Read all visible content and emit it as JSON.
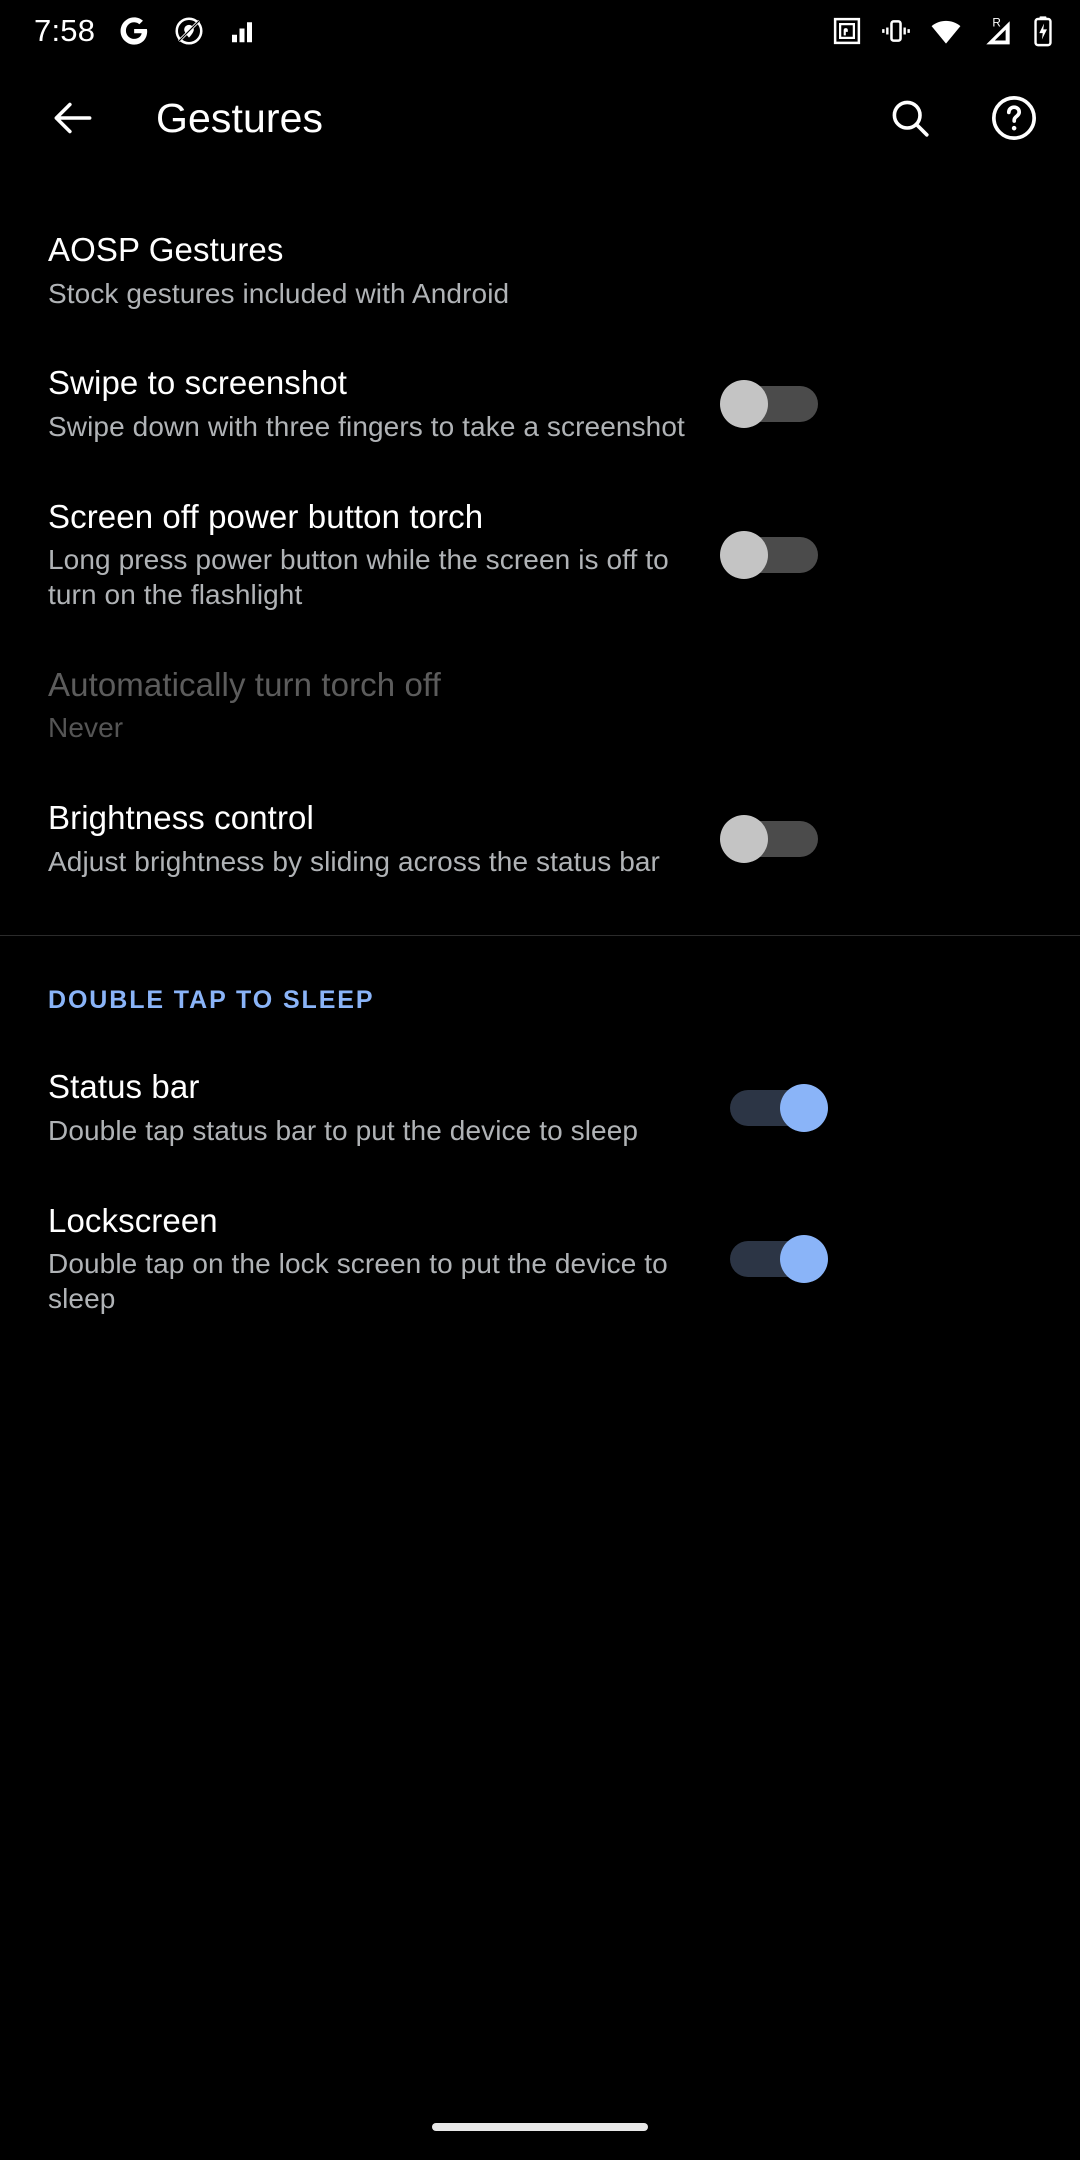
{
  "status_bar": {
    "time": "7:58",
    "left_icons": [
      "google-g-icon",
      "no-location-icon",
      "signal-bars-icon"
    ],
    "right_icons": [
      "nfc-icon",
      "vibrate-icon",
      "wifi-icon",
      "roaming-signal-icon",
      "battery-charging-icon"
    ],
    "roaming_label": "R"
  },
  "app_bar": {
    "title": "Gestures",
    "back_icon": "arrow-back-icon",
    "search_icon": "search-icon",
    "help_icon": "help-circle-icon"
  },
  "colors": {
    "background": "#000000",
    "accent": "#8ab4f8",
    "primary_text": "#ffffff",
    "secondary_text": "#b0b3b6",
    "disabled_text": "#5c5c5c",
    "switch_off_track": "#4b4b4b",
    "switch_off_thumb": "#c4c4c4",
    "switch_on_track": "#2c3545",
    "switch_on_thumb": "#8ab4f8",
    "divider": "#2b2b2b"
  },
  "sections": [
    {
      "category": null,
      "items": [
        {
          "name": "aosp-gestures",
          "title": "AOSP Gestures",
          "summary": "Stock gestures included with Android",
          "has_switch": false,
          "switch_on": null,
          "disabled": false
        },
        {
          "name": "swipe-to-screenshot",
          "title": "Swipe to screenshot",
          "summary": "Swipe down with three fingers to take a screenshot",
          "has_switch": true,
          "switch_on": false,
          "disabled": false
        },
        {
          "name": "screen-off-power-button-torch",
          "title": "Screen off power button torch",
          "summary": "Long press power button while the screen is off to turn on the flashlight",
          "has_switch": true,
          "switch_on": false,
          "disabled": false
        },
        {
          "name": "automatically-turn-torch-off",
          "title": "Automatically turn torch off",
          "summary": "Never",
          "has_switch": false,
          "switch_on": null,
          "disabled": true
        },
        {
          "name": "brightness-control",
          "title": "Brightness control",
          "summary": "Adjust brightness by sliding across the status bar",
          "has_switch": true,
          "switch_on": false,
          "disabled": false
        }
      ]
    },
    {
      "category": "DOUBLE TAP TO SLEEP",
      "items": [
        {
          "name": "status-bar",
          "title": "Status bar",
          "summary": "Double tap status bar to put the device to sleep",
          "has_switch": true,
          "switch_on": true,
          "disabled": false
        },
        {
          "name": "lockscreen",
          "title": "Lockscreen",
          "summary": "Double tap on the lock screen to put the device to sleep",
          "has_switch": true,
          "switch_on": true,
          "disabled": false
        }
      ]
    }
  ],
  "nav_bar": {
    "pill": "home-pill"
  }
}
